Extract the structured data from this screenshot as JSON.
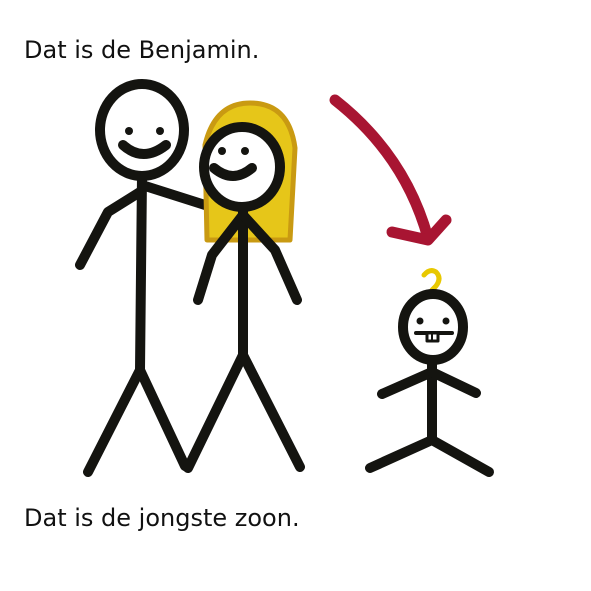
{
  "captions": {
    "top": "Dat is de Benjamin.",
    "bottom": "Dat is de jongste zoon."
  },
  "figures": {
    "father": "stick-figure-man",
    "mother": "stick-figure-woman",
    "child": "stick-figure-boy"
  },
  "icons": {
    "arrow": "curved-arrow-icon",
    "question": "question-mark-icon"
  },
  "colors": {
    "ink": "#141410",
    "hair": "#e6c619",
    "hair_outline": "#c99a12",
    "arrow": "#a81532",
    "question": "#e8c800"
  }
}
